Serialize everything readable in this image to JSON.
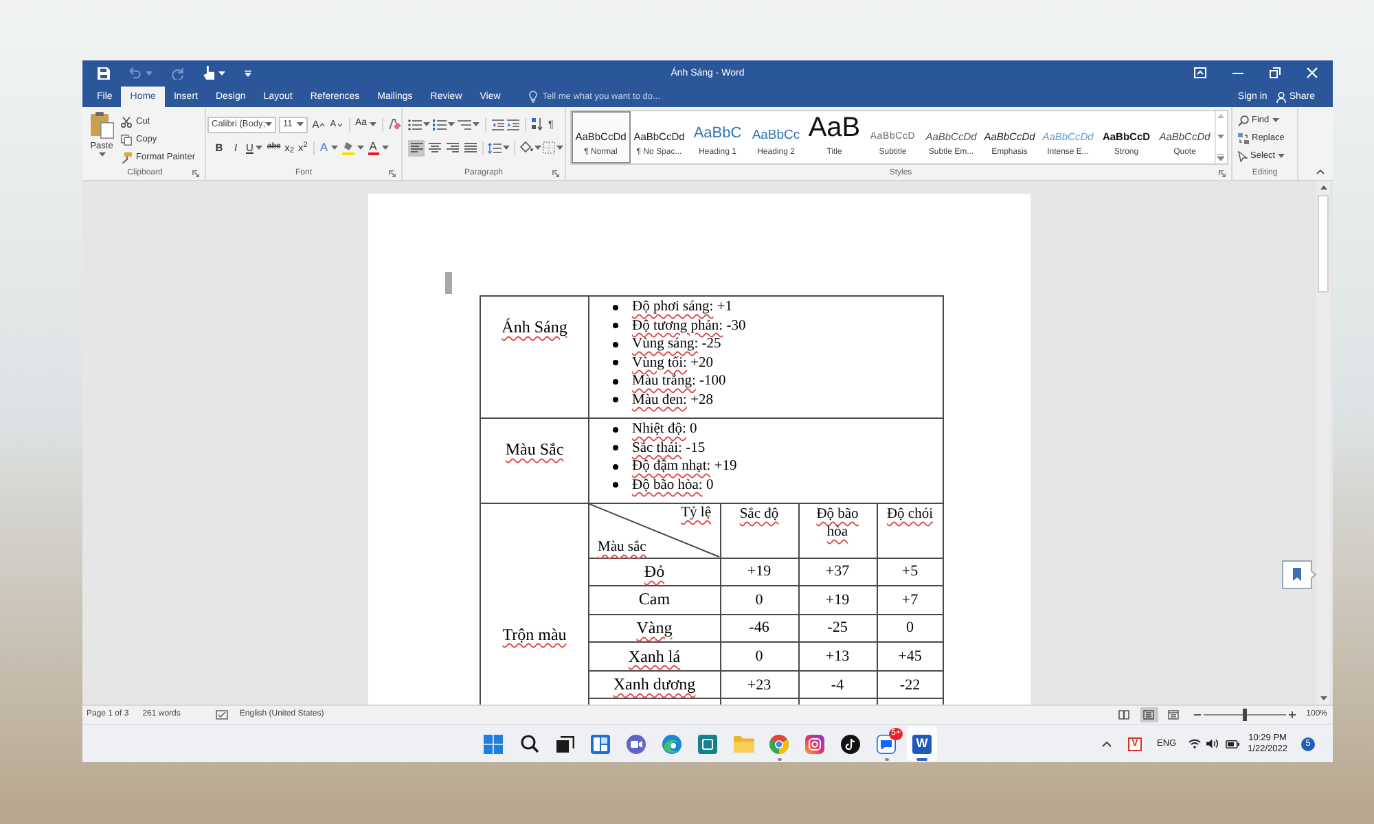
{
  "window": {
    "title": "Ánh Sáng - Word"
  },
  "quick_access": [
    {
      "kind": "save",
      "disabled": false
    },
    {
      "kind": "undo",
      "disabled": true
    },
    {
      "kind": "redo",
      "disabled": true
    },
    {
      "kind": "touch",
      "disabled": false
    },
    {
      "kind": "customize",
      "disabled": false
    }
  ],
  "tabs": [
    {
      "label": "File",
      "selected": false
    },
    {
      "label": "Home",
      "selected": true
    },
    {
      "label": "Insert",
      "selected": false
    },
    {
      "label": "Design",
      "selected": false
    },
    {
      "label": "Layout",
      "selected": false
    },
    {
      "label": "References",
      "selected": false
    },
    {
      "label": "Mailings",
      "selected": false
    },
    {
      "label": "Review",
      "selected": false
    },
    {
      "label": "View",
      "selected": false
    }
  ],
  "tell_me": {
    "placeholder": "Tell me what you want to do..."
  },
  "account": {
    "sign_in": "Sign in",
    "share": "Share"
  },
  "clipboard": {
    "label": "Clipboard",
    "paste": "Paste",
    "commands": [
      {
        "kind": "cut",
        "label": "Cut"
      },
      {
        "kind": "copy",
        "label": "Copy"
      },
      {
        "kind": "format_painter",
        "label": "Format Painter"
      }
    ]
  },
  "font": {
    "label": "Font",
    "name": "Calibri (Body;",
    "size": "11",
    "grow": "A",
    "shrink": "A",
    "change_case": "Aa",
    "bold": "B",
    "italic": "I",
    "underline": "U",
    "strikethrough": "abc",
    "subscript": "x$_{2}$",
    "superscript": "x$^{2}$",
    "text_effects": "A",
    "font_color": "A"
  },
  "paragraph": {
    "label": "Paragraph",
    "show_marks": "¶",
    "alignment": [
      {
        "kind": "left",
        "selected": true
      },
      {
        "kind": "center",
        "selected": false
      },
      {
        "kind": "right",
        "selected": false
      },
      {
        "kind": "justify",
        "selected": false
      }
    ]
  },
  "styles": {
    "label": "Styles",
    "items": [
      {
        "preview": "AaBbCcDd",
        "name": "¶ Normal",
        "kind": "normal",
        "selected": true
      },
      {
        "preview": "AaBbCcDd",
        "name": "¶ No Spac...",
        "kind": "normal",
        "selected": false
      },
      {
        "preview": "AaBbC",
        "name": "Heading 1",
        "kind": "heading1",
        "selected": false
      },
      {
        "preview": "AaBbCc",
        "name": "Heading 2",
        "kind": "heading2",
        "selected": false
      },
      {
        "preview": "AaB",
        "name": "Title",
        "kind": "title",
        "selected": false
      },
      {
        "preview": "AaBbCcD",
        "name": "Subtitle",
        "kind": "subtitle",
        "selected": false
      },
      {
        "preview": "AaBbCcDd",
        "name": "Subtle Em...",
        "kind": "subtle",
        "selected": false
      },
      {
        "preview": "AaBbCcDd",
        "name": "Emphasis",
        "kind": "emphasis",
        "selected": false
      },
      {
        "preview": "AaBbCcDd",
        "name": "Intense E...",
        "kind": "intense",
        "selected": false
      },
      {
        "preview": "AaBbCcD",
        "name": "Strong",
        "kind": "strong",
        "selected": false
      },
      {
        "preview": "AaBbCcDd",
        "name": "Quote",
        "kind": "quote",
        "selected": false
      }
    ]
  },
  "editing": {
    "label": "Editing",
    "find": "Find",
    "replace": "Replace",
    "select": "Select"
  },
  "document": {
    "sections": [
      {
        "title": "Ánh Sáng",
        "misspelled": true,
        "kind": "list",
        "items": [
          {
            "label": "Độ phơi sáng:",
            "value": "+1",
            "misspelled": true
          },
          {
            "label": "Độ tương phản:",
            "value": "-30",
            "misspelled": true
          },
          {
            "label": "Vùng sáng:",
            "value": "-25",
            "misspelled": true
          },
          {
            "label": "Vùng tối:",
            "value": "+20",
            "misspelled": true
          },
          {
            "label": "Màu trắng:",
            "value": "-100",
            "misspelled": true
          },
          {
            "label": "Màu đen:",
            "value": "+28",
            "misspelled": true
          }
        ]
      },
      {
        "title": "Màu Sắc",
        "misspelled": true,
        "kind": "list",
        "items": [
          {
            "label": "Nhiệt độ:",
            "value": "0",
            "misspelled": true
          },
          {
            "label": "Sắc thái:",
            "value": "-15",
            "misspelled": true
          },
          {
            "label": "Độ đậm nhạt:",
            "value": "+19",
            "misspelled": true
          },
          {
            "label": "Độ bão hòa:",
            "value": "0",
            "misspelled": true
          }
        ]
      },
      {
        "title": "Trộn màu",
        "misspelled": true,
        "kind": "grid",
        "corner": [
          {
            "label": "Tỷ lệ",
            "misspelled": true
          },
          {
            "label": "Màu sắc",
            "misspelled": true
          }
        ],
        "columns": [
          {
            "label": "Sắc độ",
            "misspelled": true
          },
          {
            "label": "Độ bão hòa",
            "misspelled": true
          },
          {
            "label": "Độ chói",
            "misspelled": true
          }
        ],
        "rows": [
          {
            "name": "Đỏ",
            "misspelled": true,
            "values": [
              "+19",
              "+37",
              "+5"
            ]
          },
          {
            "name": "Cam",
            "misspelled": false,
            "values": [
              "0",
              "+19",
              "+7"
            ]
          },
          {
            "name": "Vàng",
            "misspelled": true,
            "values": [
              "-46",
              "-25",
              "0"
            ]
          },
          {
            "name": "Xanh lá",
            "misspelled": true,
            "values": [
              "0",
              "+13",
              "+45"
            ]
          },
          {
            "name": "Xanh dương",
            "misspelled": true,
            "values": [
              "+23",
              "-4",
              "-22"
            ]
          }
        ]
      }
    ]
  },
  "status_bar": {
    "page": "Page 1 of 3",
    "words": "261 words",
    "language": "English (United States)",
    "views": [
      {
        "kind": "read",
        "selected": false
      },
      {
        "kind": "print",
        "selected": true
      },
      {
        "kind": "web",
        "selected": false
      }
    ],
    "zoom": {
      "level": 0.5,
      "reading": "100%"
    }
  },
  "taskbar": {
    "apps": [
      {
        "kind": "start",
        "running": false,
        "active": false
      },
      {
        "kind": "search",
        "running": false,
        "active": false
      },
      {
        "kind": "task_view",
        "running": false,
        "active": false
      },
      {
        "kind": "widgets",
        "running": false,
        "active": false
      },
      {
        "kind": "chat",
        "running": false,
        "active": false
      },
      {
        "kind": "edge",
        "running": false,
        "active": false
      },
      {
        "kind": "app",
        "running": false,
        "active": false
      },
      {
        "kind": "explorer",
        "running": false,
        "active": false
      },
      {
        "kind": "browser",
        "running": true,
        "active": false
      },
      {
        "kind": "instagram",
        "running": false,
        "active": false
      },
      {
        "kind": "tiktok",
        "running": false,
        "active": false
      },
      {
        "kind": "zalo",
        "running": true,
        "active": false,
        "badge": "5+"
      },
      {
        "kind": "word",
        "running": true,
        "active": true,
        "glyph": "W"
      }
    ],
    "tray": {
      "ime": "V",
      "language": "ENG",
      "time": "10:29 PM",
      "date": "1/22/2022",
      "notifications": "5"
    }
  }
}
